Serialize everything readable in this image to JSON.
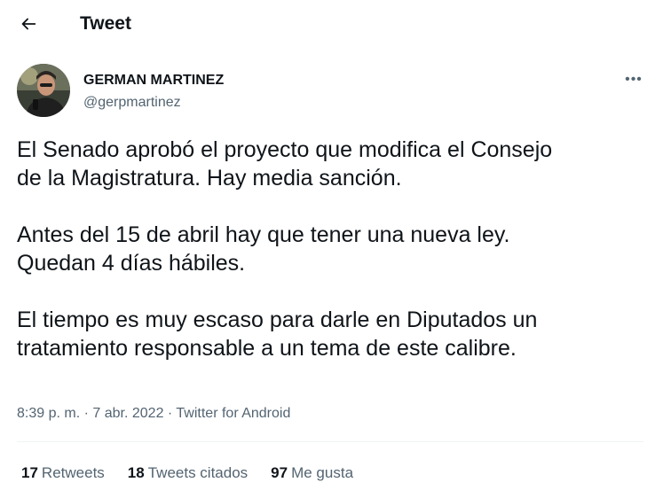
{
  "header": {
    "title": "Tweet",
    "back_icon": "arrow-left-icon"
  },
  "author": {
    "name": "GERMAN MARTINEZ",
    "handle": "@gerpmartinez",
    "more_icon": "more-horizontal-icon",
    "more_label": "•••"
  },
  "tweet": {
    "paragraphs": [
      [
        "El Senado aprobó el proyecto que modifica el Consejo",
        "de la Magistratura. Hay media sanción."
      ],
      [
        "Antes del 15 de abril hay que tener una nueva ley.",
        "Quedan 4 días hábiles."
      ],
      [
        "El tiempo es muy escaso para darle en Diputados un",
        "tratamiento responsable a un tema de este calibre."
      ]
    ],
    "time": "8:39 p. m.",
    "separator": "·",
    "date": "7 abr. 2022",
    "source": "Twitter for Android"
  },
  "stats": {
    "retweets_count": "17",
    "retweets_label": "Retweets",
    "quotes_count": "18",
    "quotes_label": "Tweets citados",
    "likes_count": "97",
    "likes_label": "Me gusta"
  },
  "colors": {
    "text_primary": "#0f1419",
    "text_secondary": "#536471",
    "divider": "#eff3f4"
  }
}
